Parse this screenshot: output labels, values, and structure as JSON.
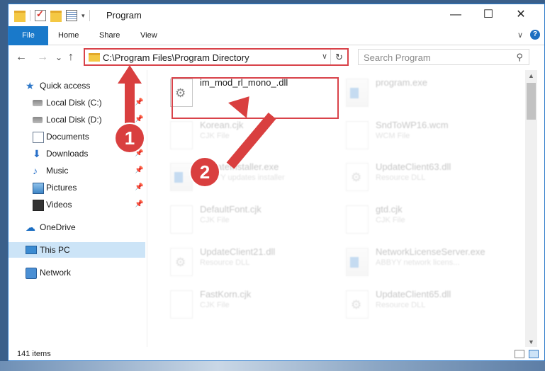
{
  "window": {
    "title": "Program",
    "controls": {
      "minimize": "—",
      "maximize": "☐",
      "close": "✕"
    }
  },
  "ribbon": {
    "tabs": [
      {
        "label": "File"
      },
      {
        "label": "Home"
      },
      {
        "label": "Share"
      },
      {
        "label": "View"
      }
    ],
    "expand_glyph": "∨",
    "help_glyph": "?"
  },
  "navigation": {
    "back": "←",
    "forward": "→",
    "recent": "⌄",
    "up": "↑",
    "address": "C:\\Program Files\\Program Directory",
    "address_dropdown": "∨",
    "refresh": "↻",
    "search_placeholder": "Search Program",
    "search_glyph": "⚲"
  },
  "sidebar": {
    "items": [
      {
        "label": "Quick access",
        "icon": "star-icon",
        "glyph": "★",
        "pinned": false,
        "selected": false
      },
      {
        "label": "Local Disk (C:)",
        "icon": "disk-icon",
        "glyph": "",
        "pinned": true,
        "selected": false
      },
      {
        "label": "Local Disk (D:)",
        "icon": "disk-icon",
        "glyph": "",
        "pinned": true,
        "selected": false
      },
      {
        "label": "Documents",
        "icon": "documents-icon",
        "glyph": "",
        "pinned": true,
        "selected": false
      },
      {
        "label": "Downloads",
        "icon": "download-icon",
        "glyph": "⬇",
        "pinned": true,
        "selected": false
      },
      {
        "label": "Music",
        "icon": "music-icon",
        "glyph": "♪",
        "pinned": true,
        "selected": false
      },
      {
        "label": "Pictures",
        "icon": "pictures-icon",
        "glyph": "",
        "pinned": true,
        "selected": false
      },
      {
        "label": "Videos",
        "icon": "videos-icon",
        "glyph": "",
        "pinned": true,
        "selected": false
      },
      {
        "label": "OneDrive",
        "icon": "cloud-icon",
        "glyph": "☁",
        "pinned": false,
        "selected": false
      },
      {
        "label": "This PC",
        "icon": "computer-icon",
        "glyph": "",
        "pinned": false,
        "selected": true
      },
      {
        "label": "Network",
        "icon": "network-icon",
        "glyph": "",
        "pinned": false,
        "selected": false
      }
    ],
    "pin_glyph": "📌"
  },
  "files": [
    {
      "name": "im_mod_rl_mono_.dll",
      "type": "",
      "icon": "dll-gear-icon",
      "faded": false
    },
    {
      "name": "program.exe",
      "type": "",
      "icon": "exe-icon",
      "faded": true
    },
    {
      "name": "Korean.cjk",
      "type": "CJK File",
      "icon": "file-icon",
      "faded": true
    },
    {
      "name": "SndToWP16.wcm",
      "type": "WCM File",
      "icon": "file-icon",
      "faded": true
    },
    {
      "name": "UpdateInstaller.exe",
      "type": "ABBYY updates installer",
      "icon": "exe-icon",
      "faded": true
    },
    {
      "name": "UpdateClient63.dll",
      "type": "Resource DLL",
      "icon": "dll-gear-icon",
      "faded": true
    },
    {
      "name": "DefaultFont.cjk",
      "type": "CJK File",
      "icon": "file-icon",
      "faded": true
    },
    {
      "name": "gtd.cjk",
      "type": "CJK File",
      "icon": "file-icon",
      "faded": true
    },
    {
      "name": "UpdateClient21.dll",
      "type": "Resource DLL",
      "icon": "dll-gear-icon",
      "faded": true
    },
    {
      "name": "NetworkLicenseServer.exe",
      "type": "ABBYY network licens...",
      "icon": "exe-icon",
      "faded": true
    },
    {
      "name": "FastKorn.cjk",
      "type": "CJK File",
      "icon": "file-icon",
      "faded": true
    },
    {
      "name": "UpdateClient65.dll",
      "type": "Resource DLL",
      "icon": "dll-gear-icon",
      "faded": true
    }
  ],
  "status": {
    "item_count": "141 items"
  },
  "callouts": {
    "step1": "1",
    "step2": "2"
  },
  "colors": {
    "accent": "#1979ca",
    "callout": "#d93f3f",
    "selected_nav": "#cce4f7"
  }
}
